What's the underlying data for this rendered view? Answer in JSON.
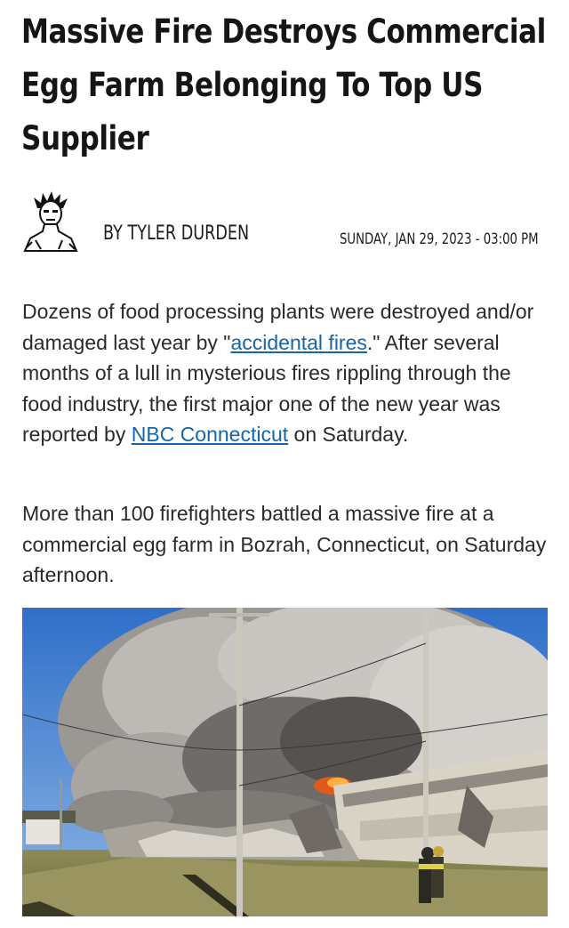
{
  "article": {
    "headline": "Massive Fire Destroys Commercial Egg Farm Belonging To Top US Supplier",
    "byline": "BY TYLER DURDEN",
    "date": "SUNDAY, JAN 29, 2023 - 03:00 PM",
    "paragraph1": {
      "text_before_link1": "Dozens of food processing plants were destroyed and/or damaged last year by \"",
      "link1": "accidental fires",
      "text_after_link1": ".\" After several months of a lull in mysterious fires rippling through the food industry, the first major one of the new year was reported by ",
      "link2": "NBC Connecticut",
      "text_after_link2": " on Saturday."
    },
    "paragraph2": "More than 100 firefighters battled a massive fire at a commercial egg farm in Bozrah, Connecticut, on Saturday afternoon."
  },
  "colors": {
    "link": "#1565a8",
    "headline": "#151515"
  },
  "icons": {
    "author_avatar": "author-avatar-icon"
  }
}
